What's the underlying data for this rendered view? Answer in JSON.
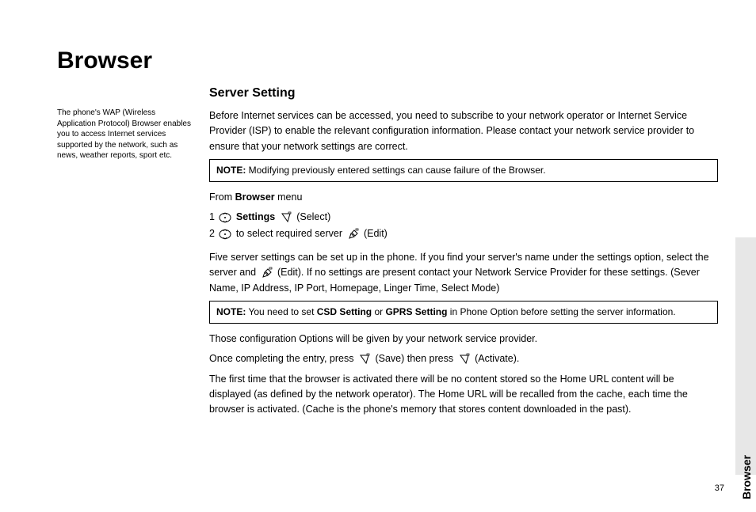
{
  "chapter_title": "Browser",
  "sidebar_text": "The phone's WAP (Wireless Application Protocol) Browser enables you to access Internet services supported by the network, such as news, weather reports, sport etc.",
  "section_title": "Server Setting",
  "intro_para": "Before Internet services can be accessed, you need to subscribe to your network operator or Internet Service Provider (ISP) to enable the relevant configuration information. Please contact your network service provider to ensure that your network settings are correct.",
  "note1_label": "NOTE:",
  "note1_text": " Modifying previously entered settings can cause failure of the Browser.",
  "from_menu_prefix": "From ",
  "from_menu_bold": "Browser",
  "from_menu_suffix": " menu",
  "step1_num": "1",
  "step1_bold": "Settings",
  "step1_action": "(Select)",
  "step2_num": "2",
  "step2_text": "to select required server",
  "step2_action": "(Edit)",
  "para2_a": "Five server settings can be set up in the phone. If you find your server's name under the settings option, select the server and ",
  "para2_b": " (Edit). If no settings are present contact your Network Service Provider for these settings. (Sever Name, IP Address, IP Port, Homepage, Linger Time, Select Mode)",
  "note2_label": "NOTE:",
  "note2_a": " You need to set ",
  "note2_b": "CSD Setting",
  "note2_c": " or ",
  "note2_d": "GPRS Setting",
  "note2_e": " in Phone Option before setting the server information.",
  "para3": "Those configuration Options will be given by your network service provider.",
  "para4_a": "Once completing the entry, press ",
  "para4_b": " (Save) then press ",
  "para4_c": " (Activate).",
  "para5": "The first time that the browser is activated there will be no content stored so the Home URL content will be displayed (as defined by the network operator). The Home URL will be recalled from the cache, each time the browser is activated. (Cache is the phone's memory that stores content downloaded in the past).",
  "side_tab_label": "Browser",
  "page_number": "37"
}
